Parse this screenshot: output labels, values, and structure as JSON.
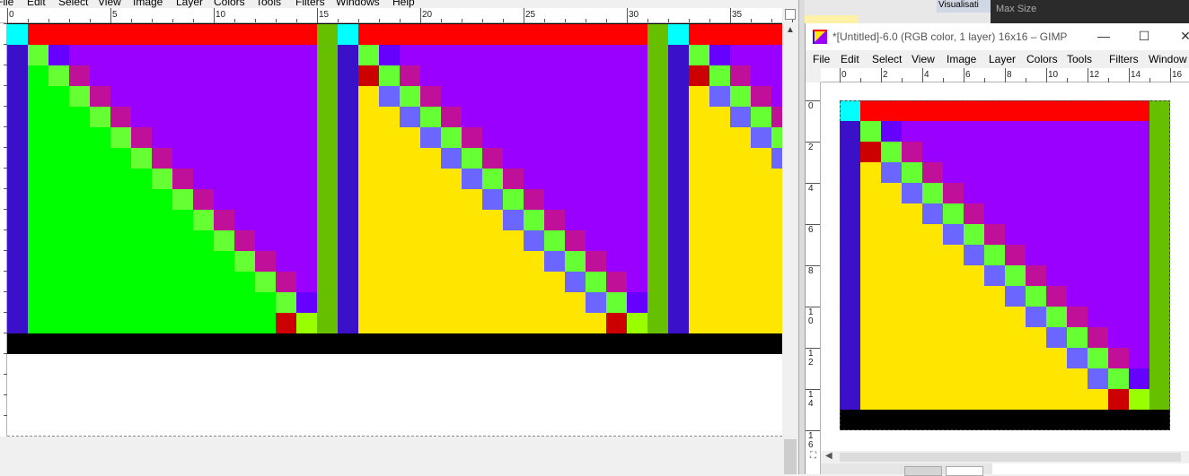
{
  "left_window": {
    "menu": [
      "File",
      "Edit",
      "Select",
      "View",
      "Image",
      "Layer",
      "Colors",
      "Tools",
      "Filters",
      "Windows",
      "Help"
    ],
    "ruler_labels": [
      "0",
      "5",
      "10",
      "15",
      "20",
      "25",
      "30",
      "35"
    ]
  },
  "background": {
    "tab_label": "Visualisati",
    "panel_label": "Max Size"
  },
  "right_window": {
    "title": "*[Untitled]-6.0 (RGB color, 1 layer) 16x16 – GIMP",
    "minimize_icon": "—",
    "maximize_icon": "☐",
    "close_icon": "✕",
    "menu": [
      "File",
      "Edit",
      "Select",
      "View",
      "Image",
      "Layer",
      "Colors",
      "Tools",
      "Filters",
      "Window"
    ],
    "hruler_labels": [
      "0",
      "2",
      "4",
      "6",
      "8",
      "10",
      "12",
      "14",
      "16"
    ],
    "vruler_labels": [
      "0",
      "2",
      "4",
      "6",
      "8",
      "1\n0",
      "1\n2",
      "1\n4",
      "1\n6"
    ]
  },
  "colors": {
    "yellow": "#ffe600",
    "blue": "#3a10c8",
    "black": "#000000",
    "red": "#ff0000",
    "dark_red": "#cc0000",
    "cyan": "#00ffff",
    "green": "#00ff00",
    "olive_green": "#66c000",
    "purple": "#9900ff",
    "magenta": "#c0109a",
    "light_green": "#66ff33",
    "periwinkle": "#6a66ff",
    "violet": "#6600ff",
    "lime": "#99ff00"
  }
}
